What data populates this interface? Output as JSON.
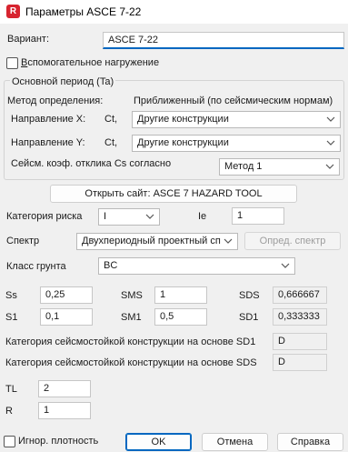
{
  "window": {
    "title": "Параметры ASCE 7-22",
    "icon_letter": "R"
  },
  "variant": {
    "label": "Вариант:",
    "value": "ASCE 7-22"
  },
  "aux_load": {
    "label": "Вспомогательное нагружение",
    "checked": false
  },
  "period_group": {
    "title": "Основной период (Ta)",
    "method_label": "Метод определения:",
    "method_value": "Приближенный (по сейсмическим нормам)",
    "dir_x_label": "Направление X:",
    "dir_x_ct": "Ct,",
    "dir_x_value": "Другие конструкции",
    "dir_y_label": "Направление Y:",
    "dir_y_ct": "Ct,",
    "dir_y_value": "Другие конструкции",
    "cs_label": "Сейсм. коэф. отклика Cs согласно",
    "cs_value": "Метод 1"
  },
  "open_site_button": "Открыть сайт: ASCE 7 HAZARD TOOL",
  "risk": {
    "label": "Категория риска",
    "value": "I",
    "ie_label": "Ie",
    "ie_value": "1"
  },
  "spectrum": {
    "label": "Спектр",
    "value": "Двухпериодный проектный сп",
    "define_button": "Опред. спектр"
  },
  "soil": {
    "label": "Класс грунта",
    "value": "BC"
  },
  "params": {
    "ss_label": "Ss",
    "ss_value": "0,25",
    "sms_label": "SMS",
    "sms_value": "1",
    "sds_label": "SDS",
    "sds_value": "0,666667",
    "s1_label": "S1",
    "s1_value": "0,1",
    "sm1_label": "SM1",
    "sm1_value": "0,5",
    "sd1_label": "SD1",
    "sd1_value": "0,333333"
  },
  "sdc_sd1": {
    "label": "Категория сейсмостойкой конструкции на основе SD1",
    "value": "D"
  },
  "sdc_sds": {
    "label": "Категория сейсмостойкой конструкции на основе SDS",
    "value": "D"
  },
  "tl": {
    "label": "TL",
    "value": "2"
  },
  "r": {
    "label": "R",
    "value": "1"
  },
  "footer": {
    "ignore_density_label": "Игнор. плотность",
    "ignore_density_checked": false,
    "ok": "OK",
    "cancel": "Отмена",
    "help": "Справка"
  },
  "colors": {
    "accent": "#0067c0",
    "app_icon": "#d7242f"
  }
}
